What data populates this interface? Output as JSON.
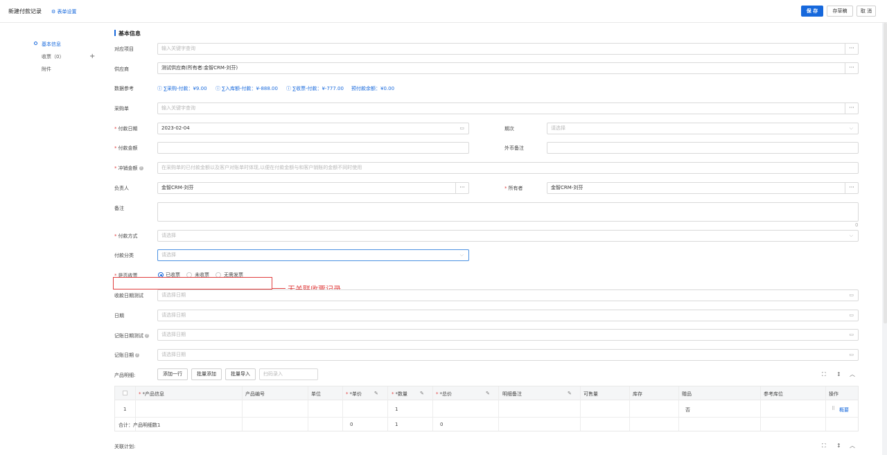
{
  "header": {
    "title": "新建付款记录",
    "form_settings": "表单设置",
    "save": "保 存",
    "draft": "存草稿",
    "cancel": "取 消"
  },
  "sidebar": {
    "items": [
      {
        "label": "基本信息",
        "active": true
      },
      {
        "label": "收票（0）"
      },
      {
        "label": "附件"
      }
    ]
  },
  "section": {
    "title": "基本信息"
  },
  "form": {
    "project": {
      "label": "对应项目",
      "placeholder": "输入关键字查询"
    },
    "supplier": {
      "label": "供应商",
      "value": "测试供应商(所有者:金智CRM-刘芬)"
    },
    "data_ref": {
      "label": "数据参考",
      "items": [
        "∑采购-付款：¥9.00",
        "∑入库额-付款：¥-888.00",
        "∑收票-付款：¥-777.00",
        "预付款余额：¥0.00"
      ]
    },
    "purchase_order": {
      "label": "采购单",
      "placeholder": "输入关键字查询"
    },
    "pay_date": {
      "label": "付款日期",
      "value": "2023-02-04"
    },
    "period": {
      "label": "期次",
      "placeholder": "请选择"
    },
    "pay_amount": {
      "label": "付款金额",
      "value": ""
    },
    "fx_note": {
      "label": "外币备注",
      "value": ""
    },
    "offset_amount": {
      "label": "冲销金额",
      "placeholder": "在采购单的已付款金额以及客户对账单时体现,以便在付款金额与和客户销账的金额不同时使用"
    },
    "owner_person": {
      "label": "负责人",
      "value": "金智CRM-刘芬"
    },
    "owner": {
      "label": "所有者",
      "value": "金智CRM-刘芬"
    },
    "remark": {
      "label": "备注",
      "count": "0"
    },
    "pay_method": {
      "label": "付款方式",
      "placeholder": "请选择"
    },
    "pay_category": {
      "label": "付款分类",
      "placeholder": "请选择"
    },
    "invoice_received": {
      "label": "是否收票",
      "options": [
        "已收票",
        "未收票",
        "无需发票"
      ],
      "selected": 0
    },
    "receipt_date_test": {
      "label": "收款日期测试",
      "placeholder": "请选择日期"
    },
    "date": {
      "label": "日期",
      "placeholder": "请选择日期"
    },
    "booking_date_test": {
      "label": "记账日期测试",
      "placeholder": "请选择日期"
    },
    "booking_date": {
      "label": "记账日期",
      "placeholder": "请选择日期"
    }
  },
  "annotation": {
    "text": "无关联收票记录",
    "color": "#e03c3c"
  },
  "products": {
    "label": "产品明细:",
    "add_row": "添加一行",
    "batch_add": "批量添加",
    "batch_import": "批量导入",
    "scan_placeholder": "扫码录入",
    "columns": [
      "*产品信息",
      "产品编号",
      "单位",
      "*单价",
      "*数量",
      "*总价",
      "明细备注",
      "可售量",
      "库存",
      "赠品",
      "参考库位",
      "操作"
    ],
    "row": {
      "index": "1",
      "qty": "1",
      "gift": "否",
      "action": "概要"
    },
    "total": {
      "label": "合计：产品明细数1",
      "unit_price": "0",
      "qty": "1",
      "total": "0"
    }
  },
  "related_plan": {
    "label": "关联计划:"
  },
  "accent": "#1668dc"
}
